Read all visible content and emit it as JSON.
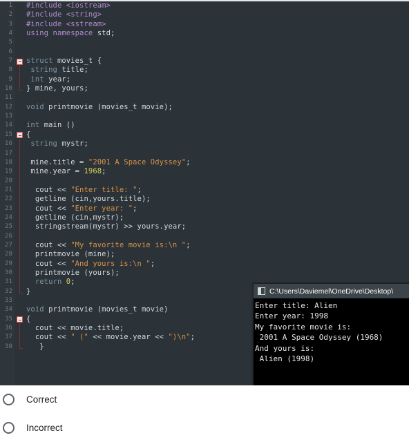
{
  "editor": {
    "name": "code-editor",
    "background_color": "#2b3338",
    "lines": [
      {
        "num": "1",
        "fold": "none",
        "tokens": [
          {
            "t": "#include <iostream>",
            "c": "pre"
          }
        ]
      },
      {
        "num": "2",
        "fold": "none",
        "tokens": [
          {
            "t": "#include <string>",
            "c": "pre"
          }
        ]
      },
      {
        "num": "3",
        "fold": "none",
        "tokens": [
          {
            "t": "#include <sstream>",
            "c": "pre"
          }
        ]
      },
      {
        "num": "4",
        "fold": "none",
        "tokens": [
          {
            "t": "using namespace ",
            "c": "kw"
          },
          {
            "t": "std;",
            "c": "plain"
          }
        ]
      },
      {
        "num": "5",
        "fold": "none",
        "tokens": []
      },
      {
        "num": "6",
        "fold": "none",
        "tokens": []
      },
      {
        "num": "7",
        "fold": "start",
        "tokens": [
          {
            "t": "struct ",
            "c": "type"
          },
          {
            "t": "movies_t {",
            "c": "plain"
          }
        ]
      },
      {
        "num": "8",
        "fold": "mid",
        "tokens": [
          {
            "t": " ",
            "c": "plain"
          },
          {
            "t": "string ",
            "c": "type"
          },
          {
            "t": "title;",
            "c": "plain"
          }
        ]
      },
      {
        "num": "9",
        "fold": "mid",
        "tokens": [
          {
            "t": " ",
            "c": "plain"
          },
          {
            "t": "int ",
            "c": "type"
          },
          {
            "t": "year;",
            "c": "plain"
          }
        ]
      },
      {
        "num": "10",
        "fold": "end",
        "tokens": [
          {
            "t": "} mine, yours;",
            "c": "plain"
          }
        ]
      },
      {
        "num": "11",
        "fold": "none",
        "tokens": []
      },
      {
        "num": "12",
        "fold": "none",
        "tokens": [
          {
            "t": "void ",
            "c": "type"
          },
          {
            "t": "printmovie (movies_t movie);",
            "c": "plain"
          }
        ]
      },
      {
        "num": "13",
        "fold": "none",
        "tokens": []
      },
      {
        "num": "14",
        "fold": "none",
        "tokens": [
          {
            "t": "int ",
            "c": "type"
          },
          {
            "t": "main ()",
            "c": "plain"
          }
        ]
      },
      {
        "num": "15",
        "fold": "start",
        "tokens": [
          {
            "t": "{",
            "c": "plain"
          }
        ]
      },
      {
        "num": "16",
        "fold": "mid",
        "tokens": [
          {
            "t": " ",
            "c": "plain"
          },
          {
            "t": "string ",
            "c": "type"
          },
          {
            "t": "mystr;",
            "c": "plain"
          }
        ]
      },
      {
        "num": "17",
        "fold": "mid",
        "tokens": []
      },
      {
        "num": "18",
        "fold": "mid",
        "tokens": [
          {
            "t": " mine.title = ",
            "c": "plain"
          },
          {
            "t": "\"2001 A Space Odyssey\"",
            "c": "str"
          },
          {
            "t": ";",
            "c": "plain"
          }
        ]
      },
      {
        "num": "19",
        "fold": "mid",
        "tokens": [
          {
            "t": " mine.year = ",
            "c": "plain"
          },
          {
            "t": "1968",
            "c": "num"
          },
          {
            "t": ";",
            "c": "plain"
          }
        ]
      },
      {
        "num": "20",
        "fold": "mid",
        "tokens": []
      },
      {
        "num": "21",
        "fold": "mid",
        "tokens": [
          {
            "t": "  cout << ",
            "c": "plain"
          },
          {
            "t": "\"Enter title: \"",
            "c": "str"
          },
          {
            "t": ";",
            "c": "plain"
          }
        ]
      },
      {
        "num": "22",
        "fold": "mid",
        "tokens": [
          {
            "t": "  getline (cin,yours.title);",
            "c": "plain"
          }
        ]
      },
      {
        "num": "23",
        "fold": "mid",
        "tokens": [
          {
            "t": "  cout << ",
            "c": "plain"
          },
          {
            "t": "\"Enter year: \"",
            "c": "str"
          },
          {
            "t": ";",
            "c": "plain"
          }
        ]
      },
      {
        "num": "24",
        "fold": "mid",
        "tokens": [
          {
            "t": "  getline (cin,mystr);",
            "c": "plain"
          }
        ]
      },
      {
        "num": "25",
        "fold": "mid",
        "tokens": [
          {
            "t": "  stringstream(mystr) >> yours.year;",
            "c": "plain"
          }
        ]
      },
      {
        "num": "26",
        "fold": "mid",
        "tokens": []
      },
      {
        "num": "27",
        "fold": "mid",
        "tokens": [
          {
            "t": "  cout << ",
            "c": "plain"
          },
          {
            "t": "\"My favorite movie is:\\n \"",
            "c": "str"
          },
          {
            "t": ";",
            "c": "plain"
          }
        ]
      },
      {
        "num": "28",
        "fold": "mid",
        "tokens": [
          {
            "t": "  printmovie (mine);",
            "c": "plain"
          }
        ]
      },
      {
        "num": "29",
        "fold": "mid",
        "tokens": [
          {
            "t": "  cout << ",
            "c": "plain"
          },
          {
            "t": "\"And yours is:\\n \"",
            "c": "str"
          },
          {
            "t": ";",
            "c": "plain"
          }
        ]
      },
      {
        "num": "30",
        "fold": "mid",
        "tokens": [
          {
            "t": "  printmovie (yours);",
            "c": "plain"
          }
        ]
      },
      {
        "num": "31",
        "fold": "mid",
        "tokens": [
          {
            "t": "  ",
            "c": "plain"
          },
          {
            "t": "return ",
            "c": "type"
          },
          {
            "t": "0",
            "c": "num"
          },
          {
            "t": ";",
            "c": "plain"
          }
        ]
      },
      {
        "num": "32",
        "fold": "end",
        "tokens": [
          {
            "t": "}",
            "c": "plain"
          }
        ]
      },
      {
        "num": "33",
        "fold": "none",
        "tokens": []
      },
      {
        "num": "34",
        "fold": "none",
        "tokens": [
          {
            "t": "void ",
            "c": "type"
          },
          {
            "t": "printmovie (movies_t movie)",
            "c": "plain"
          }
        ]
      },
      {
        "num": "35",
        "fold": "start",
        "tokens": [
          {
            "t": "{",
            "c": "plain"
          }
        ]
      },
      {
        "num": "36",
        "fold": "mid",
        "tokens": [
          {
            "t": "  cout << movie.title;",
            "c": "plain"
          }
        ]
      },
      {
        "num": "37",
        "fold": "mid",
        "tokens": [
          {
            "t": "  cout << ",
            "c": "plain"
          },
          {
            "t": "\" (\"",
            "c": "str"
          },
          {
            "t": " << movie.year << ",
            "c": "plain"
          },
          {
            "t": "\")\\n\"",
            "c": "str"
          },
          {
            "t": ";",
            "c": "plain"
          }
        ]
      },
      {
        "num": "38",
        "fold": "end",
        "tokens": [
          {
            "t": "   }",
            "c": "plain"
          }
        ]
      }
    ]
  },
  "console": {
    "title": "C:\\Users\\Daviemel\\OneDrive\\Desktop\\",
    "icon": "console-window-icon",
    "output": "Enter title: Alien\nEnter year: 1998\nMy favorite movie is:\n 2001 A Space Odyssey (1968)\nAnd yours is:\n Alien (1998)"
  },
  "options": {
    "name": "answer-choices",
    "items": [
      {
        "label": "Correct",
        "selected": false
      },
      {
        "label": "Incorrect",
        "selected": false
      }
    ]
  }
}
